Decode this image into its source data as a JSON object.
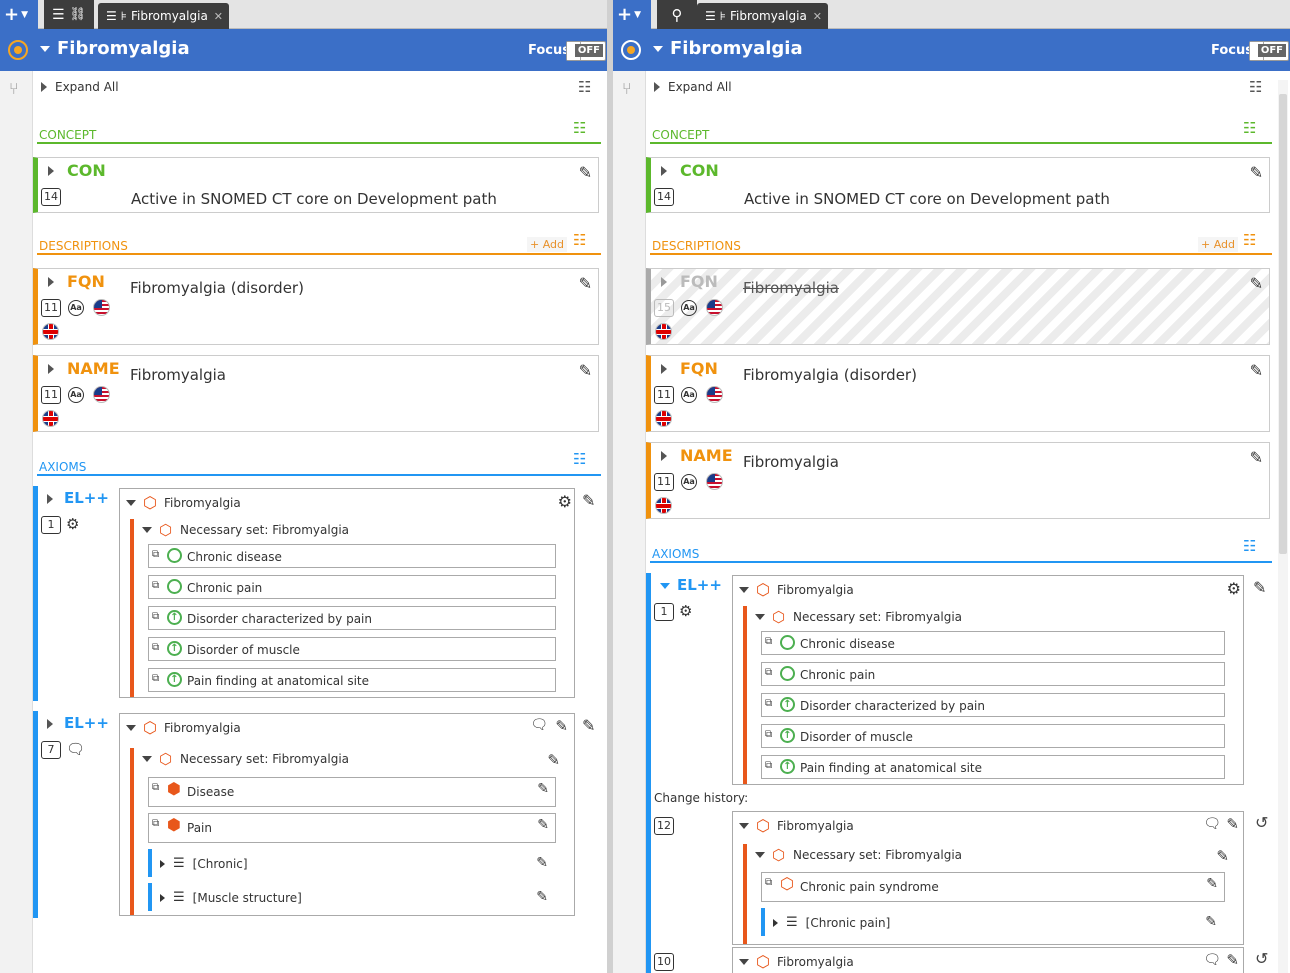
{
  "colors": {
    "brand": "#3b6fc7",
    "concept": "#5cb82c",
    "descriptions": "#f0920e",
    "axioms": "#2196f3",
    "hex": "#e8571b",
    "check": "#4caf50"
  },
  "left": {
    "tab_label": "Fibromyalgia",
    "title": "Fibromyalgia",
    "focus_label": "Focus",
    "focus_state": "OFF",
    "expand_all": "Expand All",
    "concept_head": "CONCEPT",
    "descriptions_head": "DESCRIPTIONS",
    "add_label": "+ Add",
    "axioms_head": "AXIOMS",
    "concept": {
      "type": "CON",
      "badge": "14",
      "status": "Active in SNOMED CT core on Development path"
    },
    "descs": [
      {
        "type": "FQN",
        "badge": "11",
        "term": "Fibromyalgia (disorder)"
      },
      {
        "type": "NAME",
        "badge": "11",
        "term": "Fibromyalgia"
      }
    ],
    "axiom1": {
      "type": "EL++",
      "badge": "1",
      "concept": "Fibromyalgia",
      "necessary": "Necessary set: Fibromyalgia",
      "items": [
        "Chronic disease",
        "Chronic pain",
        "Disorder characterized by pain",
        "Disorder of muscle",
        "Pain finding at anatomical site"
      ]
    },
    "axiom2": {
      "type": "EL++",
      "badge": "7",
      "concept": "Fibromyalgia",
      "necessary": "Necessary set: Fibromyalgia",
      "items": [
        "Disease",
        "Pain"
      ],
      "groups": [
        "[Chronic]",
        "[Muscle structure]"
      ]
    }
  },
  "right": {
    "tab_label": "Fibromyalgia",
    "title": "Fibromyalgia",
    "focus_label": "Focus",
    "focus_state": "OFF",
    "expand_all": "Expand All",
    "concept_head": "CONCEPT",
    "descriptions_head": "DESCRIPTIONS",
    "add_label": "+ Add",
    "axioms_head": "AXIOMS",
    "concept": {
      "type": "CON",
      "badge": "14",
      "status": "Active in SNOMED CT core on Development path"
    },
    "descs": [
      {
        "type": "FQN",
        "badge": "15",
        "term": "Fibromyalgia"
      },
      {
        "type": "FQN",
        "badge": "11",
        "term": "Fibromyalgia (disorder)"
      },
      {
        "type": "NAME",
        "badge": "11",
        "term": "Fibromyalgia"
      }
    ],
    "axiom1": {
      "type": "EL++",
      "badge": "1",
      "concept": "Fibromyalgia",
      "necessary": "Necessary set: Fibromyalgia",
      "items": [
        "Chronic disease",
        "Chronic pain",
        "Disorder characterized by pain",
        "Disorder of muscle",
        "Pain finding at anatomical site"
      ]
    },
    "change_history": "Change history:",
    "hist1": {
      "badge": "12",
      "concept": "Fibromyalgia",
      "necessary": "Necessary set: Fibromyalgia",
      "item": "Chronic pain syndrome",
      "group": "[Chronic pain]"
    },
    "hist2": {
      "badge": "10",
      "concept": "Fibromyalgia"
    }
  }
}
